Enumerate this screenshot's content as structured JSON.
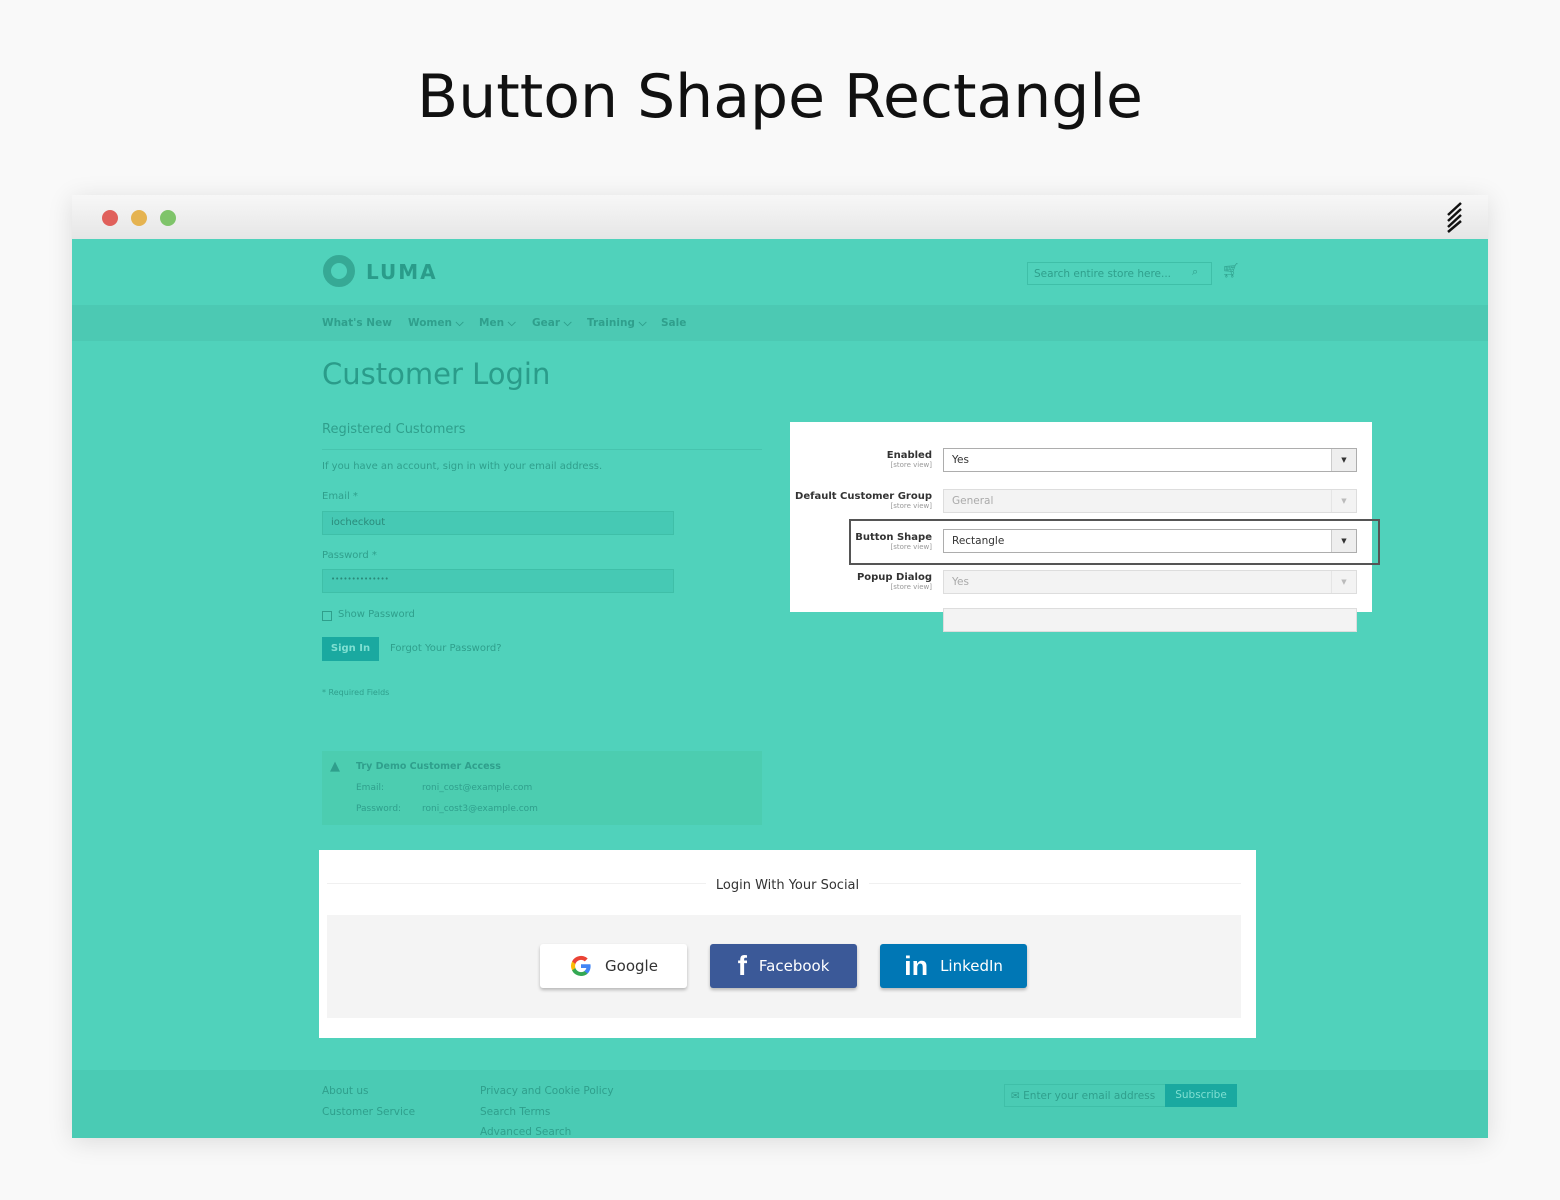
{
  "headline": "Button Shape Rectangle",
  "store": {
    "logo": "LUMA",
    "search_placeholder": "Search entire store here...",
    "nav": [
      "What's New",
      "Women",
      "Men",
      "Gear",
      "Training",
      "Sale"
    ],
    "page_title": "Customer Login",
    "section_title": "Registered Customers",
    "intro": "If you have an account, sign in with your email address.",
    "email_label": "Email",
    "email_value": "iocheckout",
    "password_label": "Password",
    "password_value": "••••••••••••••",
    "show_password": "Show Password",
    "sign_in": "Sign In",
    "forgot": "Forgot Your Password?",
    "required": "* Required Fields",
    "demo": {
      "title": "Try Demo Customer Access",
      "email_label": "Email:",
      "email": "roni_cost@example.com",
      "password_label": "Password:",
      "password": "roni_cost3@example.com"
    }
  },
  "admin": {
    "rows": [
      {
        "label": "Enabled",
        "scope": "[store view]",
        "value": "Yes",
        "disabled": false
      },
      {
        "label": "Default Customer Group",
        "scope": "[store view]",
        "value": "General",
        "disabled": true
      },
      {
        "label": "Button Shape",
        "scope": "[store view]",
        "value": "Rectangle",
        "disabled": false,
        "highlighted": true
      },
      {
        "label": "Popup Dialog",
        "scope": "[store view]",
        "value": "Yes",
        "disabled": true
      }
    ]
  },
  "social": {
    "title": "Login With Your Social",
    "buttons": [
      {
        "label": "Google",
        "icon": "google-icon",
        "color": "#ffffff"
      },
      {
        "label": "Facebook",
        "icon": "facebook-icon",
        "color": "#3b5998"
      },
      {
        "label": "LinkedIn",
        "icon": "linkedin-icon",
        "color": "#0077b5"
      }
    ]
  },
  "footer": {
    "links1": [
      "About us",
      "Customer Service"
    ],
    "links2": [
      "Privacy and Cookie Policy",
      "Search Terms",
      "Advanced Search"
    ],
    "newsletter_placeholder": "Enter your email address",
    "subscribe": "Subscribe"
  }
}
